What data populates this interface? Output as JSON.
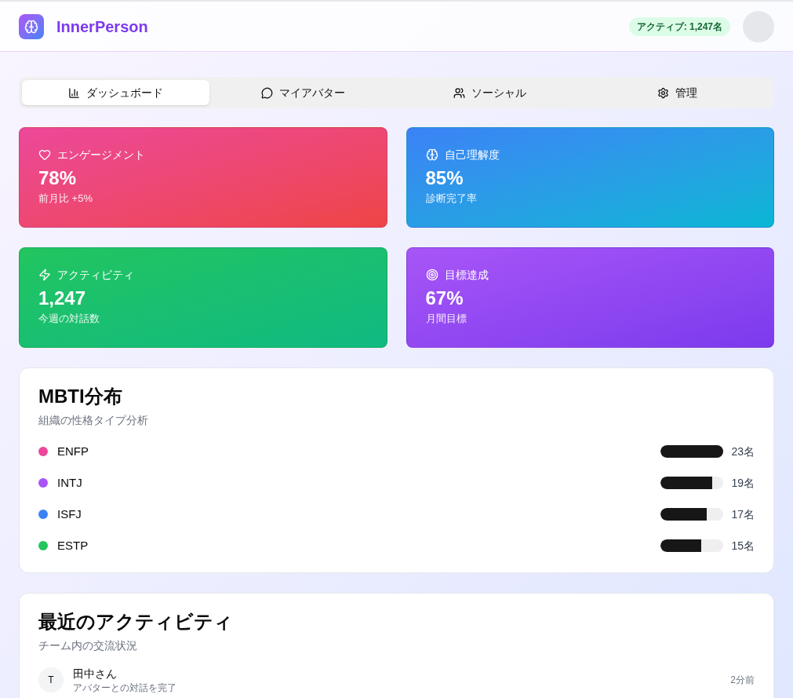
{
  "header": {
    "brand": "InnerPerson",
    "active_badge": "アクティブ: 1,247名"
  },
  "tabs": [
    {
      "label": "ダッシュボード",
      "selected": true
    },
    {
      "label": "マイアバター",
      "selected": false
    },
    {
      "label": "ソーシャル",
      "selected": false
    },
    {
      "label": "管理",
      "selected": false
    }
  ],
  "stats": [
    {
      "kind": "pink",
      "label": "エンゲージメント",
      "value": "78%",
      "caption": "前月比 +5%"
    },
    {
      "kind": "blue",
      "label": "自己理解度",
      "value": "85%",
      "caption": "診断完了率"
    },
    {
      "kind": "green",
      "label": "アクティビティ",
      "value": "1,247",
      "caption": "今週の対話数"
    },
    {
      "kind": "purple",
      "label": "目標達成",
      "value": "67%",
      "caption": "月間目標"
    }
  ],
  "mbti": {
    "title": "MBTI分布",
    "subtitle": "組織の性格タイプ分析",
    "types": [
      {
        "name": "ENFP",
        "color": "#ec4899",
        "level": 1.0,
        "count": "23名"
      },
      {
        "name": "INTJ",
        "color": "#a855f7",
        "level": 0.82,
        "count": "19名"
      },
      {
        "name": "ISFJ",
        "color": "#3b82f6",
        "level": 0.74,
        "count": "17名"
      },
      {
        "name": "ESTP",
        "color": "#22c55e",
        "level": 0.65,
        "count": "15名"
      }
    ]
  },
  "activity": {
    "title": "最近のアクティビティ",
    "subtitle": "チーム内の交流状況",
    "items": [
      {
        "initial": "T",
        "name": "田中さん",
        "action": "アバターとの対話を完了",
        "time": "2分前"
      }
    ]
  }
}
